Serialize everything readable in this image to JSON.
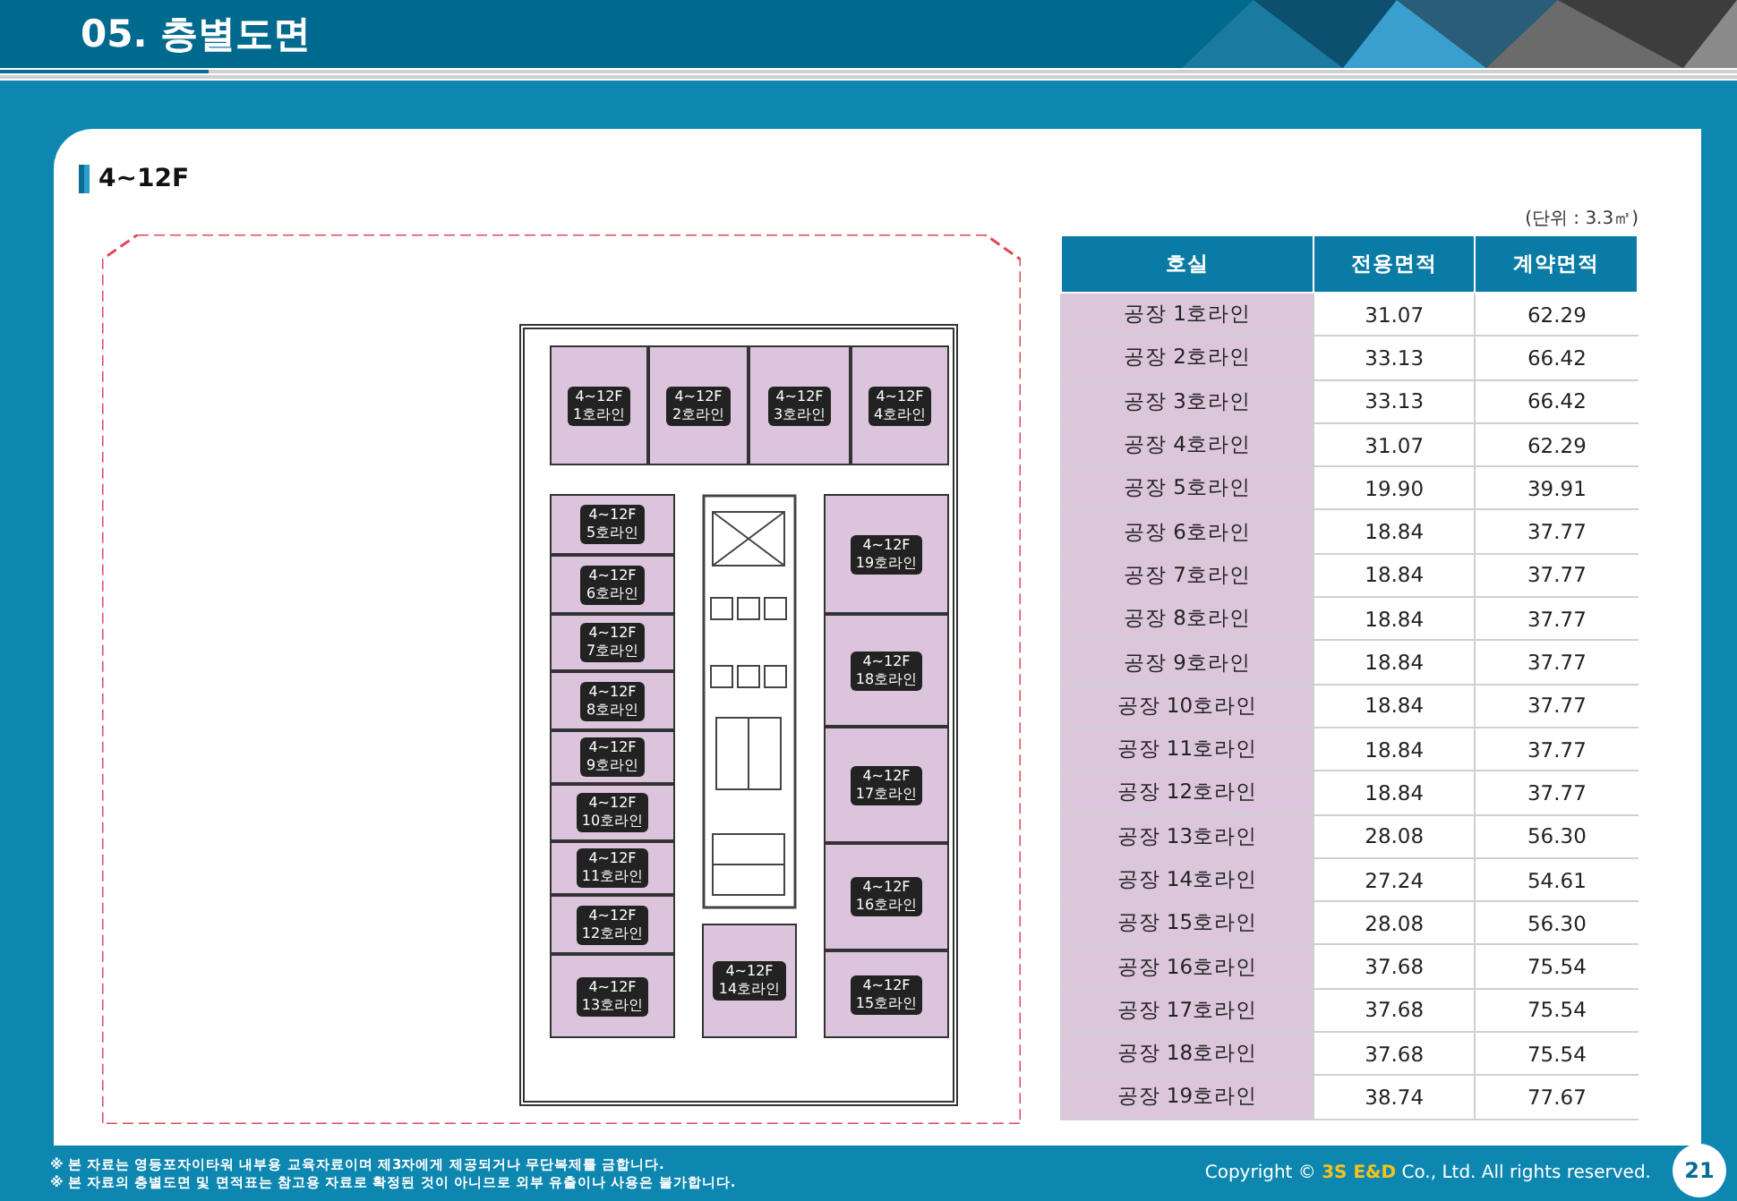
{
  "header": {
    "title": "05. 층별도면"
  },
  "section": {
    "title": "4~12F"
  },
  "plan": {
    "units": [
      {
        "floor": "4~12F",
        "line": "1호라인"
      },
      {
        "floor": "4~12F",
        "line": "2호라인"
      },
      {
        "floor": "4~12F",
        "line": "3호라인"
      },
      {
        "floor": "4~12F",
        "line": "4호라인"
      },
      {
        "floor": "4~12F",
        "line": "5호라인"
      },
      {
        "floor": "4~12F",
        "line": "6호라인"
      },
      {
        "floor": "4~12F",
        "line": "7호라인"
      },
      {
        "floor": "4~12F",
        "line": "8호라인"
      },
      {
        "floor": "4~12F",
        "line": "9호라인"
      },
      {
        "floor": "4~12F",
        "line": "10호라인"
      },
      {
        "floor": "4~12F",
        "line": "11호라인"
      },
      {
        "floor": "4~12F",
        "line": "12호라인"
      },
      {
        "floor": "4~12F",
        "line": "13호라인"
      },
      {
        "floor": "4~12F",
        "line": "14호라인"
      },
      {
        "floor": "4~12F",
        "line": "19호라인"
      },
      {
        "floor": "4~12F",
        "line": "18호라인"
      },
      {
        "floor": "4~12F",
        "line": "17호라인"
      },
      {
        "floor": "4~12F",
        "line": "16호라인"
      },
      {
        "floor": "4~12F",
        "line": "15호라인"
      }
    ]
  },
  "table": {
    "unit_note": "(단위 : 3.3㎡)",
    "columns": [
      "호실",
      "전용면적",
      "계약면적"
    ],
    "rows": [
      [
        "공장 1호라인",
        "31.07",
        "62.29"
      ],
      [
        "공장 2호라인",
        "33.13",
        "66.42"
      ],
      [
        "공장 3호라인",
        "33.13",
        "66.42"
      ],
      [
        "공장 4호라인",
        "31.07",
        "62.29"
      ],
      [
        "공장 5호라인",
        "19.90",
        "39.91"
      ],
      [
        "공장 6호라인",
        "18.84",
        "37.77"
      ],
      [
        "공장 7호라인",
        "18.84",
        "37.77"
      ],
      [
        "공장 8호라인",
        "18.84",
        "37.77"
      ],
      [
        "공장 9호라인",
        "18.84",
        "37.77"
      ],
      [
        "공장 10호라인",
        "18.84",
        "37.77"
      ],
      [
        "공장 11호라인",
        "18.84",
        "37.77"
      ],
      [
        "공장 12호라인",
        "18.84",
        "37.77"
      ],
      [
        "공장 13호라인",
        "28.08",
        "56.30"
      ],
      [
        "공장 14호라인",
        "27.24",
        "54.61"
      ],
      [
        "공장 15호라인",
        "28.08",
        "56.30"
      ],
      [
        "공장 16호라인",
        "37.68",
        "75.54"
      ],
      [
        "공장 17호라인",
        "37.68",
        "75.54"
      ],
      [
        "공장 18호라인",
        "37.68",
        "75.54"
      ],
      [
        "공장 19호라인",
        "38.74",
        "77.67"
      ]
    ]
  },
  "footnotes": [
    "※ 본 자료는 영등포자이타워 내부용 교육자료이며 제3자에게 제공되거나 무단복제를 금합니다.",
    "※ 본 자료의 층별도면 및 면적표는 참고용 자료로 확정된 것이 아니므로 외부 유출이나 사용은 불가합니다."
  ],
  "copyright": {
    "prefix": "Copyright ©",
    "brand": "3S E&D",
    "suffix": "Co., Ltd. All rights reserved."
  },
  "page_number": "21"
}
